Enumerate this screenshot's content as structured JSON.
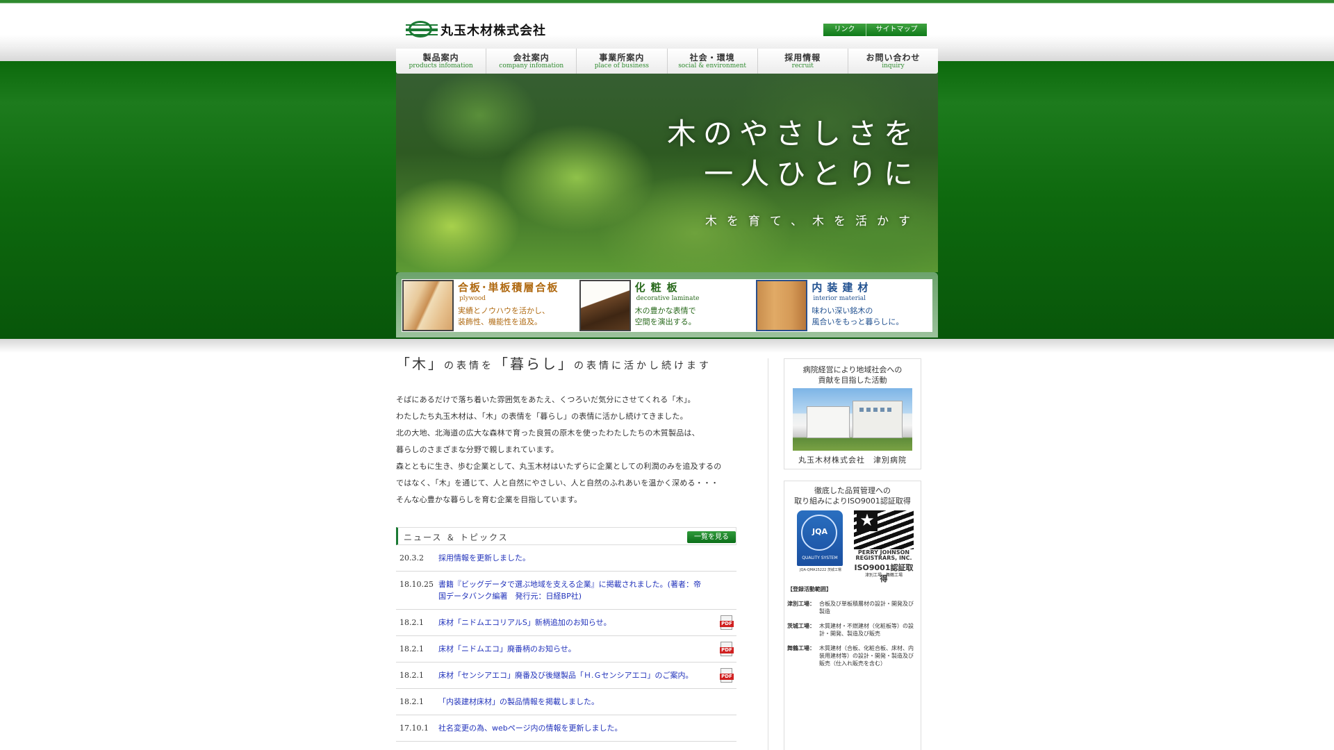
{
  "header": {
    "company_name": "丸玉木材株式会社",
    "links": [
      "リンク",
      "サイトマップ"
    ]
  },
  "nav": [
    {
      "jp": "製品案内",
      "en": "products infomation"
    },
    {
      "jp": "会社案内",
      "en": "company infomation"
    },
    {
      "jp": "事業所案内",
      "en": "place of business"
    },
    {
      "jp": "社会・環境",
      "en": "social & environment"
    },
    {
      "jp": "採用情報",
      "en": "recruit"
    },
    {
      "jp": "お問い合わせ",
      "en": "inquiry"
    }
  ],
  "hero": {
    "line1": "木のやさしさを",
    "line2": "一人ひとりに",
    "sub": "木を育て、木を活かす"
  },
  "products": [
    {
      "title": "合板･単板積層合板",
      "en": "plywood",
      "desc1": "実績とノウハウを活かし、",
      "desc2": "装飾性、機能性を追及。"
    },
    {
      "title": "化粧板",
      "en": "decorative laminate",
      "desc1": "木の豊かな表情で",
      "desc2": "空間を演出する。"
    },
    {
      "title": "内装建材",
      "en": "interior material",
      "desc1": "味わい深い銘木の",
      "desc2": "風合いをもっと暮らしに。"
    }
  ],
  "main": {
    "heading_kanji1": "「木」",
    "heading_mid": "の表情を",
    "heading_kanji2": "「暮らし」",
    "heading_end": "の表情に活かし続けます",
    "intro": [
      "そばにあるだけで落ち着いた雰囲気をあたえ、くつろいだ気分にさせてくれる「木」。",
      "わたしたち丸玉木材は、「木」の表情を「暮らし」の表情に活かし続けてきました。",
      "北の大地、北海道の広大な森林で育った良質の原木を使ったわたしたちの木質製品は、",
      "暮らしのさまざまな分野で親しまれています。",
      "森とともに生き、歩む企業として、丸玉木材はいたずらに企業としての利潤のみを追及するの",
      "ではなく、「木」を通じて、人と自然にやさしい、人と自然のふれあいを温かく深める・・・",
      "そんな心豊かな暮らしを育む企業を目指しています。"
    ]
  },
  "news": {
    "title": "ニュース ＆ トピックス",
    "more_label": "一覧を見る",
    "items": [
      {
        "date": "20.3.2",
        "text": "採用情報を更新しました。",
        "pdf": false
      },
      {
        "date": "18.10.25",
        "text": "書籍『ビッグデータで選ぶ地域を支える企業』に掲載されました。(著者：帝国データバンク編著　発行元：日経BP社)",
        "pdf": false
      },
      {
        "date": "18.2.1",
        "text": "床材「ニドムエコリアルS」新柄追加のお知らせ。",
        "pdf": true
      },
      {
        "date": "18.2.1",
        "text": "床材「ニドムエコ」廃番柄のお知らせ。",
        "pdf": true
      },
      {
        "date": "18.2.1",
        "text": "床材「センシアエコ」廃番及び後継製品「Ｈ.Ｇセンシアエコ」のご案内。",
        "pdf": true
      },
      {
        "date": "18.2.1",
        "text": "「内装建材床材」の製品情報を掲載しました。",
        "pdf": false
      },
      {
        "date": "17.10.1",
        "text": "社名変更の為、webページ内の情報を更新しました。",
        "pdf": false
      }
    ]
  },
  "sidebar": {
    "hospital": {
      "title1": "病院経営により地域社会への",
      "title2": "貢献を目指した活動",
      "caption": "丸玉木材株式会社　津別病院"
    },
    "iso": {
      "title1": "徹底した品質管理への",
      "title2": "取り組みによりISO9001認証取得",
      "jqa_label": "JQA",
      "jqa_bottom": "QUALITY SYSTEM",
      "jqa_caption": "JQA-QMA15222 茨城工場",
      "pj_label": "PERRY JOHNSON REGISTRARS, INC.",
      "pj_caption": "ISO9001認証取得",
      "pj_sub": "津別工場、舞鶴工場",
      "scope_title": "【登録活動範囲】",
      "scope": [
        {
          "plant": "津別工場：",
          "desc": "合板及び単板積層材の設計・開発及び製造"
        },
        {
          "plant": "茨城工場：",
          "desc": "木質建材・不燃建材（化粧板等）の設計・開発、製造及び販売"
        },
        {
          "plant": "舞鶴工場：",
          "desc": "木質建材（合板、化粧合板、床材、内装用建材等）の設計・開発・製造及び販売（仕入れ販売を含む）"
        }
      ]
    }
  },
  "colors": {
    "brand_green": "#1b7a34",
    "link_blue": "#2233bb",
    "plywood_orange": "#b06a12",
    "laminate_green": "#2a6a1e",
    "interior_blue": "#1f4f8f"
  }
}
